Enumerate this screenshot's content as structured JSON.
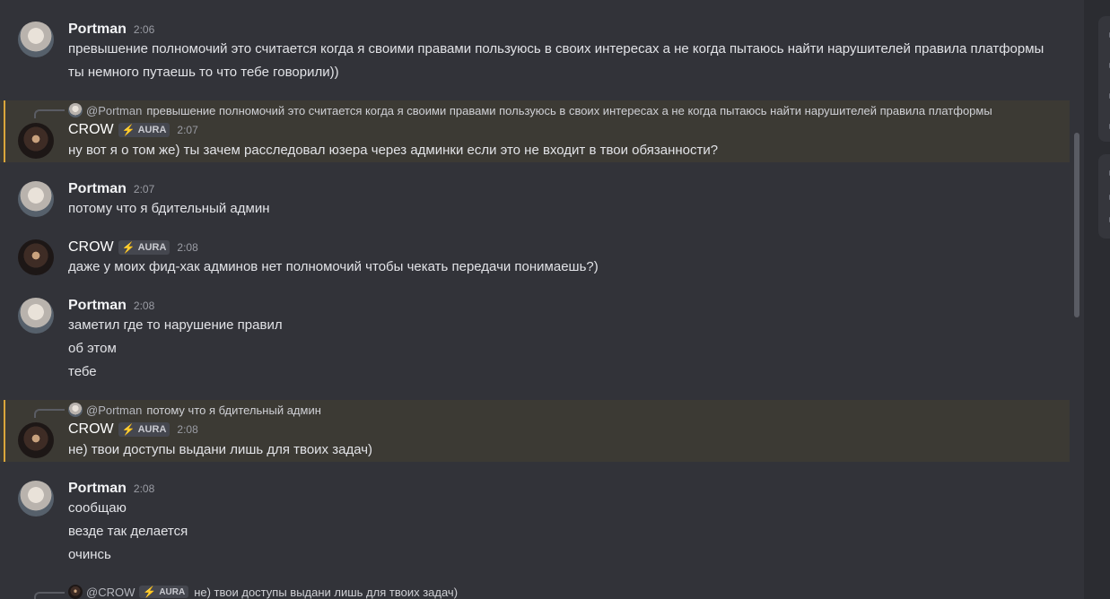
{
  "messages": [
    {
      "author": "Portman",
      "time": "2:06",
      "lines": [
        "превышение полномочий это считается когда я своими правами пользуюсь в своих интересах а не когда пытаюсь найти нарушителей правила платформы",
        "ты немного путаешь то что тебе говорили))"
      ]
    },
    {
      "author": "CROW",
      "tag": "AURA",
      "time": "2:07",
      "reply": {
        "author": "@Portman",
        "text": "превышение полномочий это считается когда я своими правами пользуюсь в своих интересах а не когда пытаюсь найти нарушителей правила платформы"
      },
      "lines": [
        "ну вот я о том же) ты зачем расследовал юзера через админки если это не входит в твои обязанности?"
      ]
    },
    {
      "author": "Portman",
      "time": "2:07",
      "lines": [
        "потому что я бдительный админ"
      ]
    },
    {
      "author": "CROW",
      "tag": "AURA",
      "time": "2:08",
      "lines": [
        "даже у моих фид-хак админов нет полномочий чтобы чекать передачи понимаешь?)"
      ]
    },
    {
      "author": "Portman",
      "time": "2:08",
      "lines": [
        "заметил где то нарушение правил",
        "об этом",
        "тебе"
      ]
    },
    {
      "author": "CROW",
      "tag": "AURA",
      "time": "2:08",
      "reply": {
        "author": "@Portman",
        "text": "потому что я бдительный админ"
      },
      "lines": [
        "не) твои доступы выдани лишь для твоих задач)"
      ]
    },
    {
      "author": "Portman",
      "time": "2:08",
      "lines": [
        "сообщаю",
        "везде так делается",
        "очинсь"
      ]
    }
  ],
  "pending_reply": {
    "author": "@CROW",
    "tag": "AURA",
    "text": "не) твои доступы выдани лишь для твоих задач)"
  },
  "icons": {
    "tag_icon": "lightning-bolt-icon"
  },
  "colors": {
    "background": "#323339",
    "mention_highlight": "#3c3a34",
    "mention_bar": "#d9a63b",
    "tag_bolt": "#3ba55c"
  }
}
